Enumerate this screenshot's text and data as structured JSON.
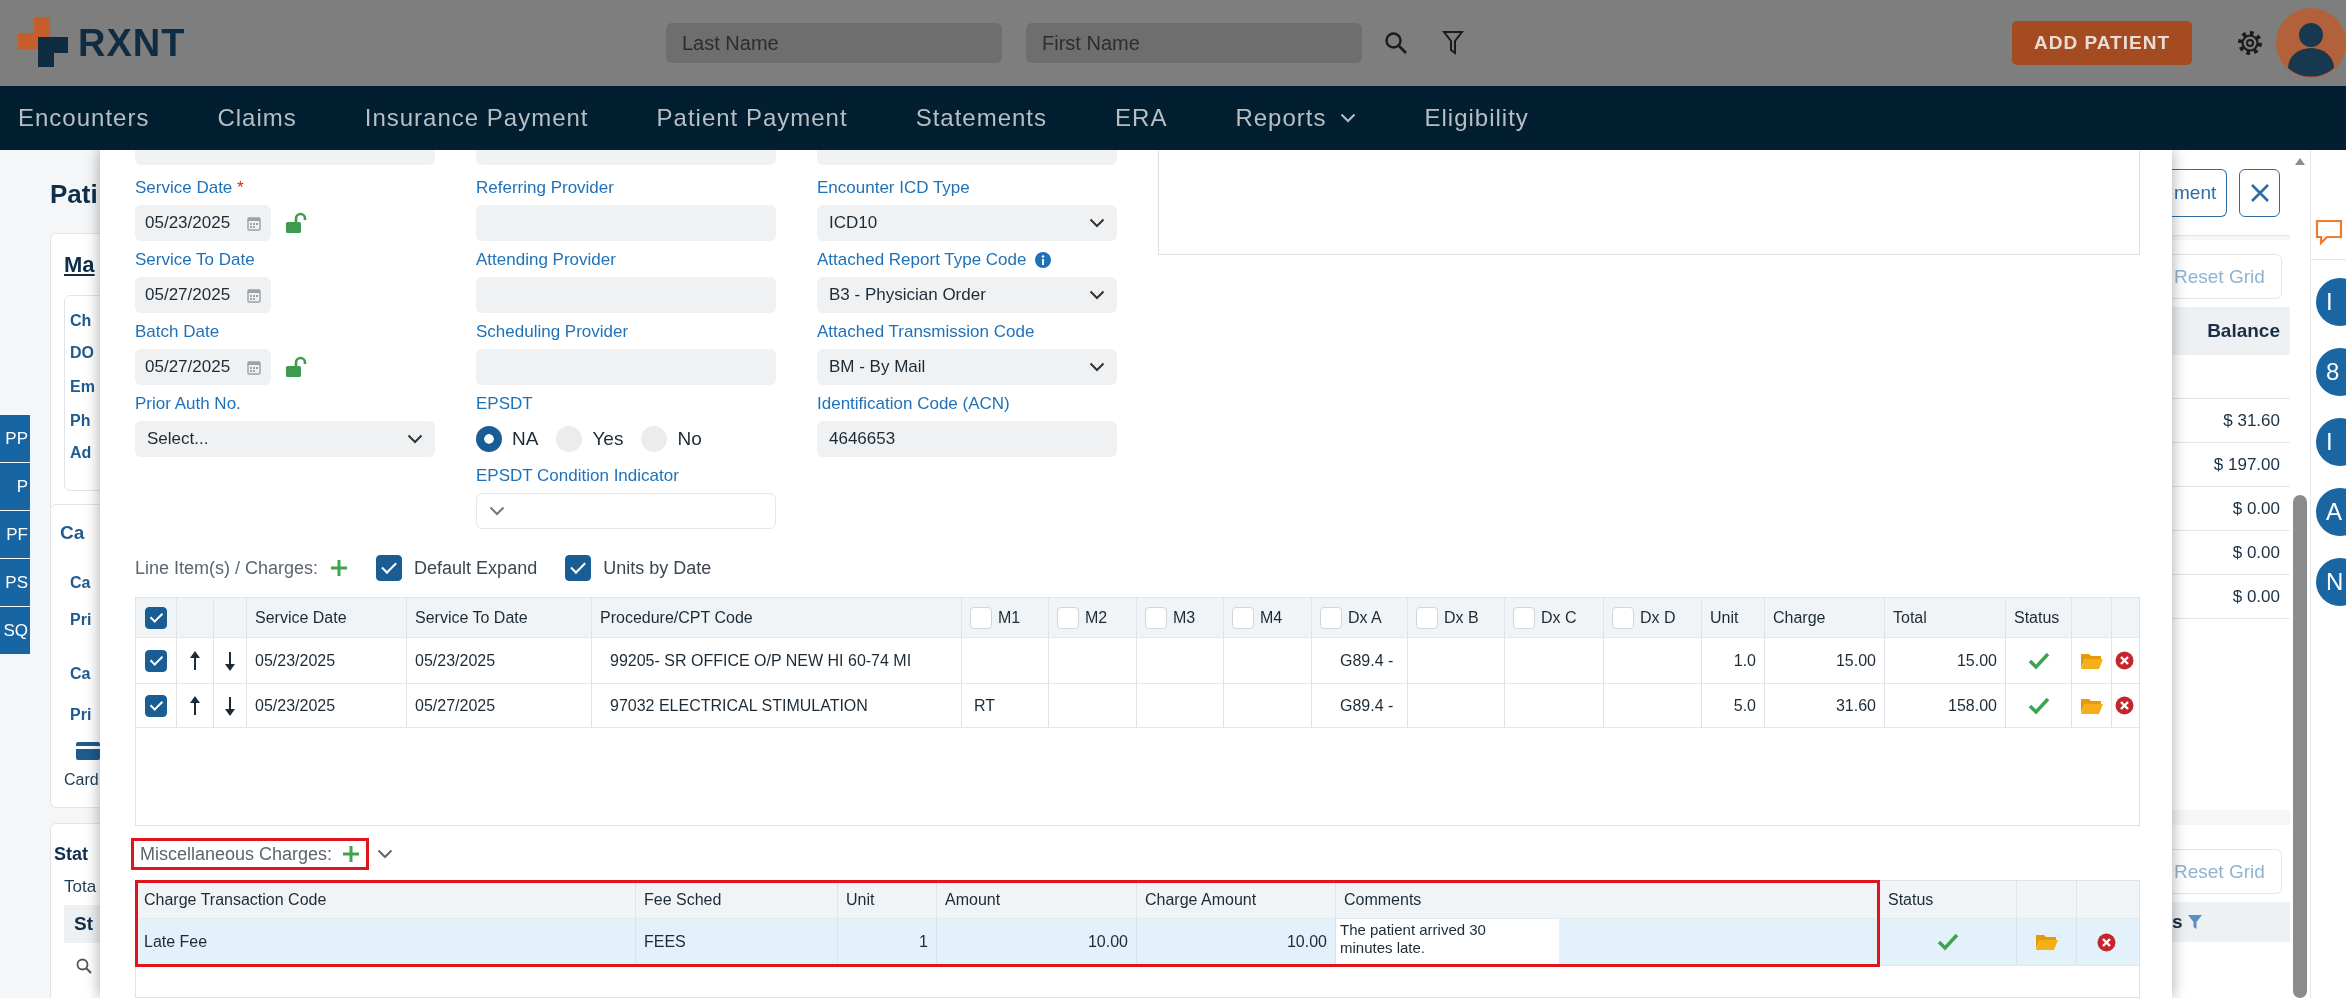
{
  "header": {
    "logo": "RXNT",
    "search_fields": [
      {
        "placeholder": "Last Name"
      },
      {
        "placeholder": "First Name"
      }
    ],
    "add_button": "ADD PATIENT"
  },
  "nav": {
    "items": [
      {
        "label": "Encounters",
        "dropdown": false
      },
      {
        "label": "Claims",
        "dropdown": false
      },
      {
        "label": "Insurance Payment",
        "dropdown": false
      },
      {
        "label": "Patient Payment",
        "dropdown": false
      },
      {
        "label": "Statements",
        "dropdown": false
      },
      {
        "label": "ERA",
        "dropdown": false
      },
      {
        "label": "Reports",
        "dropdown": true
      },
      {
        "label": "Eligibility",
        "dropdown": false
      }
    ]
  },
  "patient_panel": {
    "title": "Pati",
    "link": "Ma",
    "labels": [
      "Ch",
      "DO",
      "Em",
      "Ph",
      "Ad"
    ],
    "side_tabs": [
      "PP",
      "P",
      "PF",
      "PS",
      "SQ"
    ],
    "card_labels": [
      "Ca",
      "Ca",
      "Pri",
      "Ca",
      "Pri"
    ],
    "card_caption": "Card",
    "statements_title": "Stat",
    "statements_subtitle": "Tota",
    "table_header": "St"
  },
  "form": {
    "columns": [
      [
        {
          "kind": "date",
          "label": "Service Date",
          "required_mark": "*",
          "value": "05/23/2025",
          "unlocked": true
        },
        {
          "kind": "date",
          "label": "Service To Date",
          "value": "05/27/2025",
          "unlocked": false
        },
        {
          "kind": "date",
          "label": "Batch Date",
          "value": "05/27/2025",
          "unlocked": true
        },
        {
          "kind": "select",
          "label": "Prior Auth No.",
          "value": "Select..."
        }
      ],
      [
        {
          "kind": "text",
          "label": "Referring Provider"
        },
        {
          "kind": "text",
          "label": "Attending Provider"
        },
        {
          "kind": "text",
          "label": "Scheduling Provider"
        },
        {
          "kind": "radio",
          "label": "EPSDT",
          "options": [
            {
              "label": "NA",
              "selected": true
            },
            {
              "label": "Yes",
              "selected": false
            },
            {
              "label": "No",
              "selected": false
            }
          ]
        },
        {
          "kind": "select",
          "label": "EPSDT Condition Indicator"
        }
      ],
      [
        {
          "kind": "select",
          "label": "Encounter ICD Type",
          "value": "ICD10"
        },
        {
          "kind": "select",
          "label": "Attached Report Type Code",
          "value": "B3 - Physician Order",
          "info": true
        },
        {
          "kind": "select",
          "label": "Attached Transmission Code",
          "value": "BM - By Mail"
        },
        {
          "kind": "text",
          "label": "Identification Code (ACN)",
          "value": "4646653"
        }
      ]
    ]
  },
  "line_items": {
    "label": "Line Item(s) / Charges:",
    "options": [
      {
        "label": "Default Expand",
        "checked": true
      },
      {
        "label": "Units by Date",
        "checked": true
      }
    ],
    "select_all_checked": true,
    "columns": [
      {
        "label": "Service Date"
      },
      {
        "label": "Service To Date"
      },
      {
        "label": "Procedure/CPT Code"
      },
      {
        "label": "M1",
        "checked": false
      },
      {
        "label": "M2",
        "checked": false
      },
      {
        "label": "M3",
        "checked": false
      },
      {
        "label": "M4",
        "checked": false
      },
      {
        "label": "Dx A",
        "checked": false
      },
      {
        "label": "Dx B",
        "checked": false
      },
      {
        "label": "Dx C",
        "checked": false
      },
      {
        "label": "Dx D",
        "checked": false
      },
      {
        "label": "Unit"
      },
      {
        "label": "Charge"
      },
      {
        "label": "Total"
      },
      {
        "label": "Status"
      }
    ],
    "rows": [
      {
        "checked": true,
        "service_date": "05/23/2025",
        "service_to_date": "05/23/2025",
        "procedure": "99205- SR OFFICE O/P NEW HI 60-74 MI",
        "dx_a": "G89.4 -",
        "unit": "1.0",
        "charge": "15.00",
        "total": "15.00",
        "valid": true
      },
      {
        "checked": true,
        "service_date": "05/23/2025",
        "service_to_date": "05/27/2025",
        "procedure": "97032 ELECTRICAL STIMULATION",
        "m1": "RT",
        "dx_a": "G89.4 -",
        "unit": "5.0",
        "charge": "31.60",
        "total": "158.00",
        "valid": true
      }
    ]
  },
  "misc_charges": {
    "label": "Miscellaneous Charges:",
    "label_highlighted": true,
    "table_highlighted": true,
    "columns": [
      "Charge Transaction Code",
      "Fee Sched",
      "Unit",
      "Amount",
      "Charge Amount",
      "Comments",
      "Status"
    ],
    "rows": [
      {
        "selected": true,
        "code": "Late Fee",
        "fee_sched": "FEES",
        "unit": "1",
        "amount": "10.00",
        "charge_amount": "10.00",
        "comments": "The patient arrived 30 minutes late.",
        "valid": true
      }
    ]
  },
  "claims_panel": {
    "button": "ment",
    "reset_grid": "Reset Grid",
    "column_header": "Balance",
    "balances": [
      "$ 31.60",
      "$ 197.00",
      "$ 0.00",
      "$ 0.00",
      "$ 0.00"
    ],
    "reset_grid_2": "Reset Grid",
    "column_header_2": "s"
  },
  "side_rail": {
    "badges": [
      "I",
      "8",
      "I",
      "A",
      "N"
    ]
  }
}
